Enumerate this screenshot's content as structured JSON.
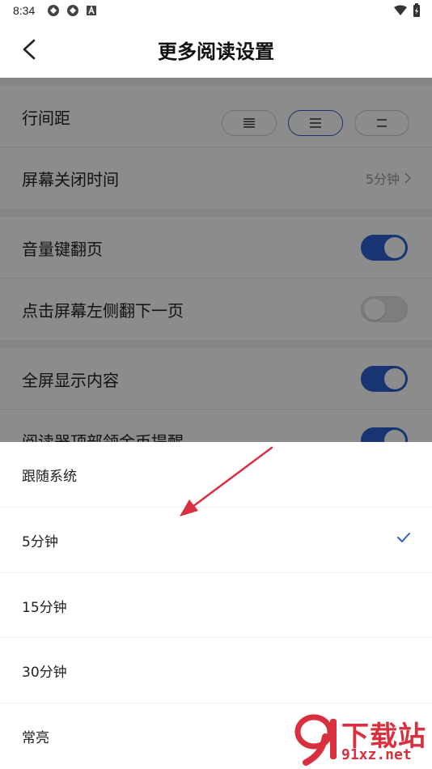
{
  "status_bar": {
    "time": "8:34"
  },
  "app_bar": {
    "title": "更多阅读设置"
  },
  "settings": {
    "line_spacing": {
      "label": "行间距",
      "options": [
        "≣",
        "☰",
        "⚌"
      ]
    },
    "screen_off": {
      "label": "屏幕关闭时间",
      "value": "5分钟"
    },
    "volume_page": {
      "label": "音量键翻页",
      "enabled": true
    },
    "tap_left": {
      "label": "点击屏幕左侧翻下一页",
      "enabled": false
    },
    "fullscreen": {
      "label": "全屏显示内容",
      "enabled": true
    },
    "coin_reminder": {
      "label": "阅读器顶部领金币提醒",
      "enabled": true
    }
  },
  "sheet": {
    "options": [
      {
        "label": "跟随系统",
        "selected": false
      },
      {
        "label": "5分钟",
        "selected": true
      },
      {
        "label": "15分钟",
        "selected": false
      },
      {
        "label": "30分钟",
        "selected": false
      },
      {
        "label": "常亮",
        "selected": false
      }
    ]
  },
  "watermark": {
    "title": "下载站",
    "url": "91xz.net"
  },
  "colors": {
    "accent": "#2f5fcf",
    "annotation_arrow": "#d9303f"
  }
}
